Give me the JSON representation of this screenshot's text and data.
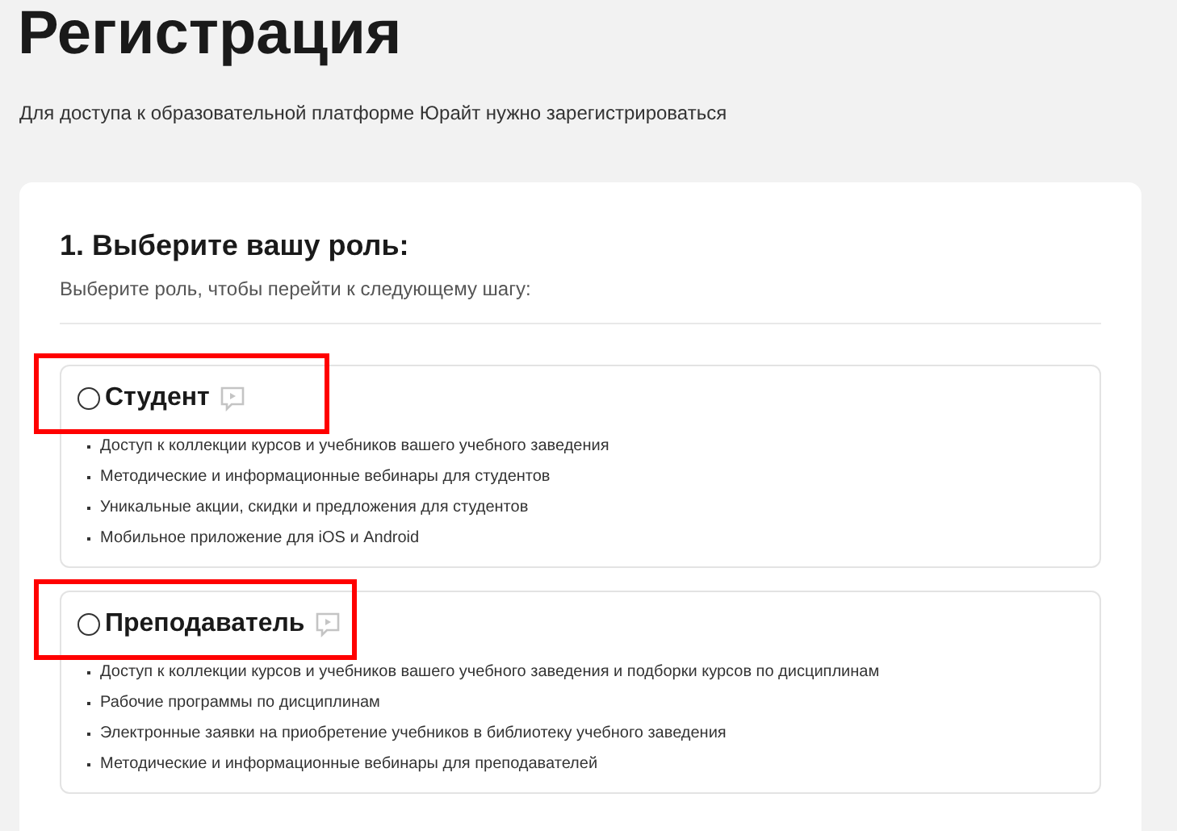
{
  "title": "Регистрация",
  "subtitle": "Для доступа к образовательной платформе Юрайт нужно зарегистрироваться",
  "step": {
    "heading": "1. Выберите вашу роль:",
    "hint": "Выберите роль, чтобы перейти к следующему шагу:"
  },
  "roles": [
    {
      "name": "Студент",
      "selected": false,
      "highlighted": true,
      "features": [
        "Доступ к коллекции курсов и учебников вашего учебного заведения",
        "Методические и информационные вебинары для студентов",
        "Уникальные акции, скидки и предложения для студентов",
        "Мобильное приложение для iOS и Android"
      ]
    },
    {
      "name": "Преподаватель",
      "selected": false,
      "highlighted": true,
      "features": [
        "Доступ к коллекции курсов и учебников вашего учебного заведения и подборки курсов по дисциплинам",
        "Рабочие программы по дисциплинам",
        "Электронные заявки на приобретение учебников в библиотеку учебного заведения",
        "Методические и информационные вебинары для преподавателей"
      ]
    }
  ]
}
